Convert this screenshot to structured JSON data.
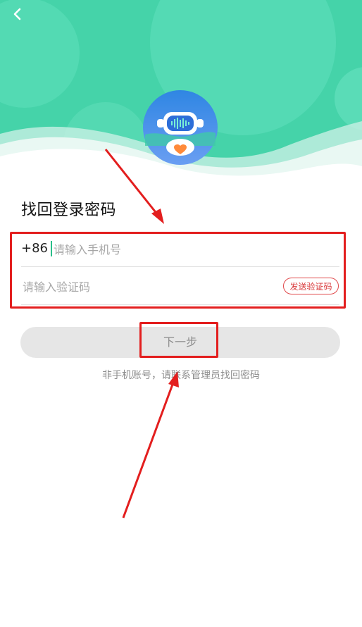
{
  "header": {
    "back_label": "‹"
  },
  "page": {
    "title": "找回登录密码"
  },
  "form": {
    "country_code": "+86",
    "phone_placeholder": "请输入手机号",
    "code_placeholder": "请输入验证码",
    "send_code_label": "发送验证码"
  },
  "actions": {
    "next_label": "下一步"
  },
  "note": "非手机账号，请联系管理员找回密码",
  "colors": {
    "brand_green": "#3ed1a7",
    "annotation_red": "#e31e1e"
  }
}
